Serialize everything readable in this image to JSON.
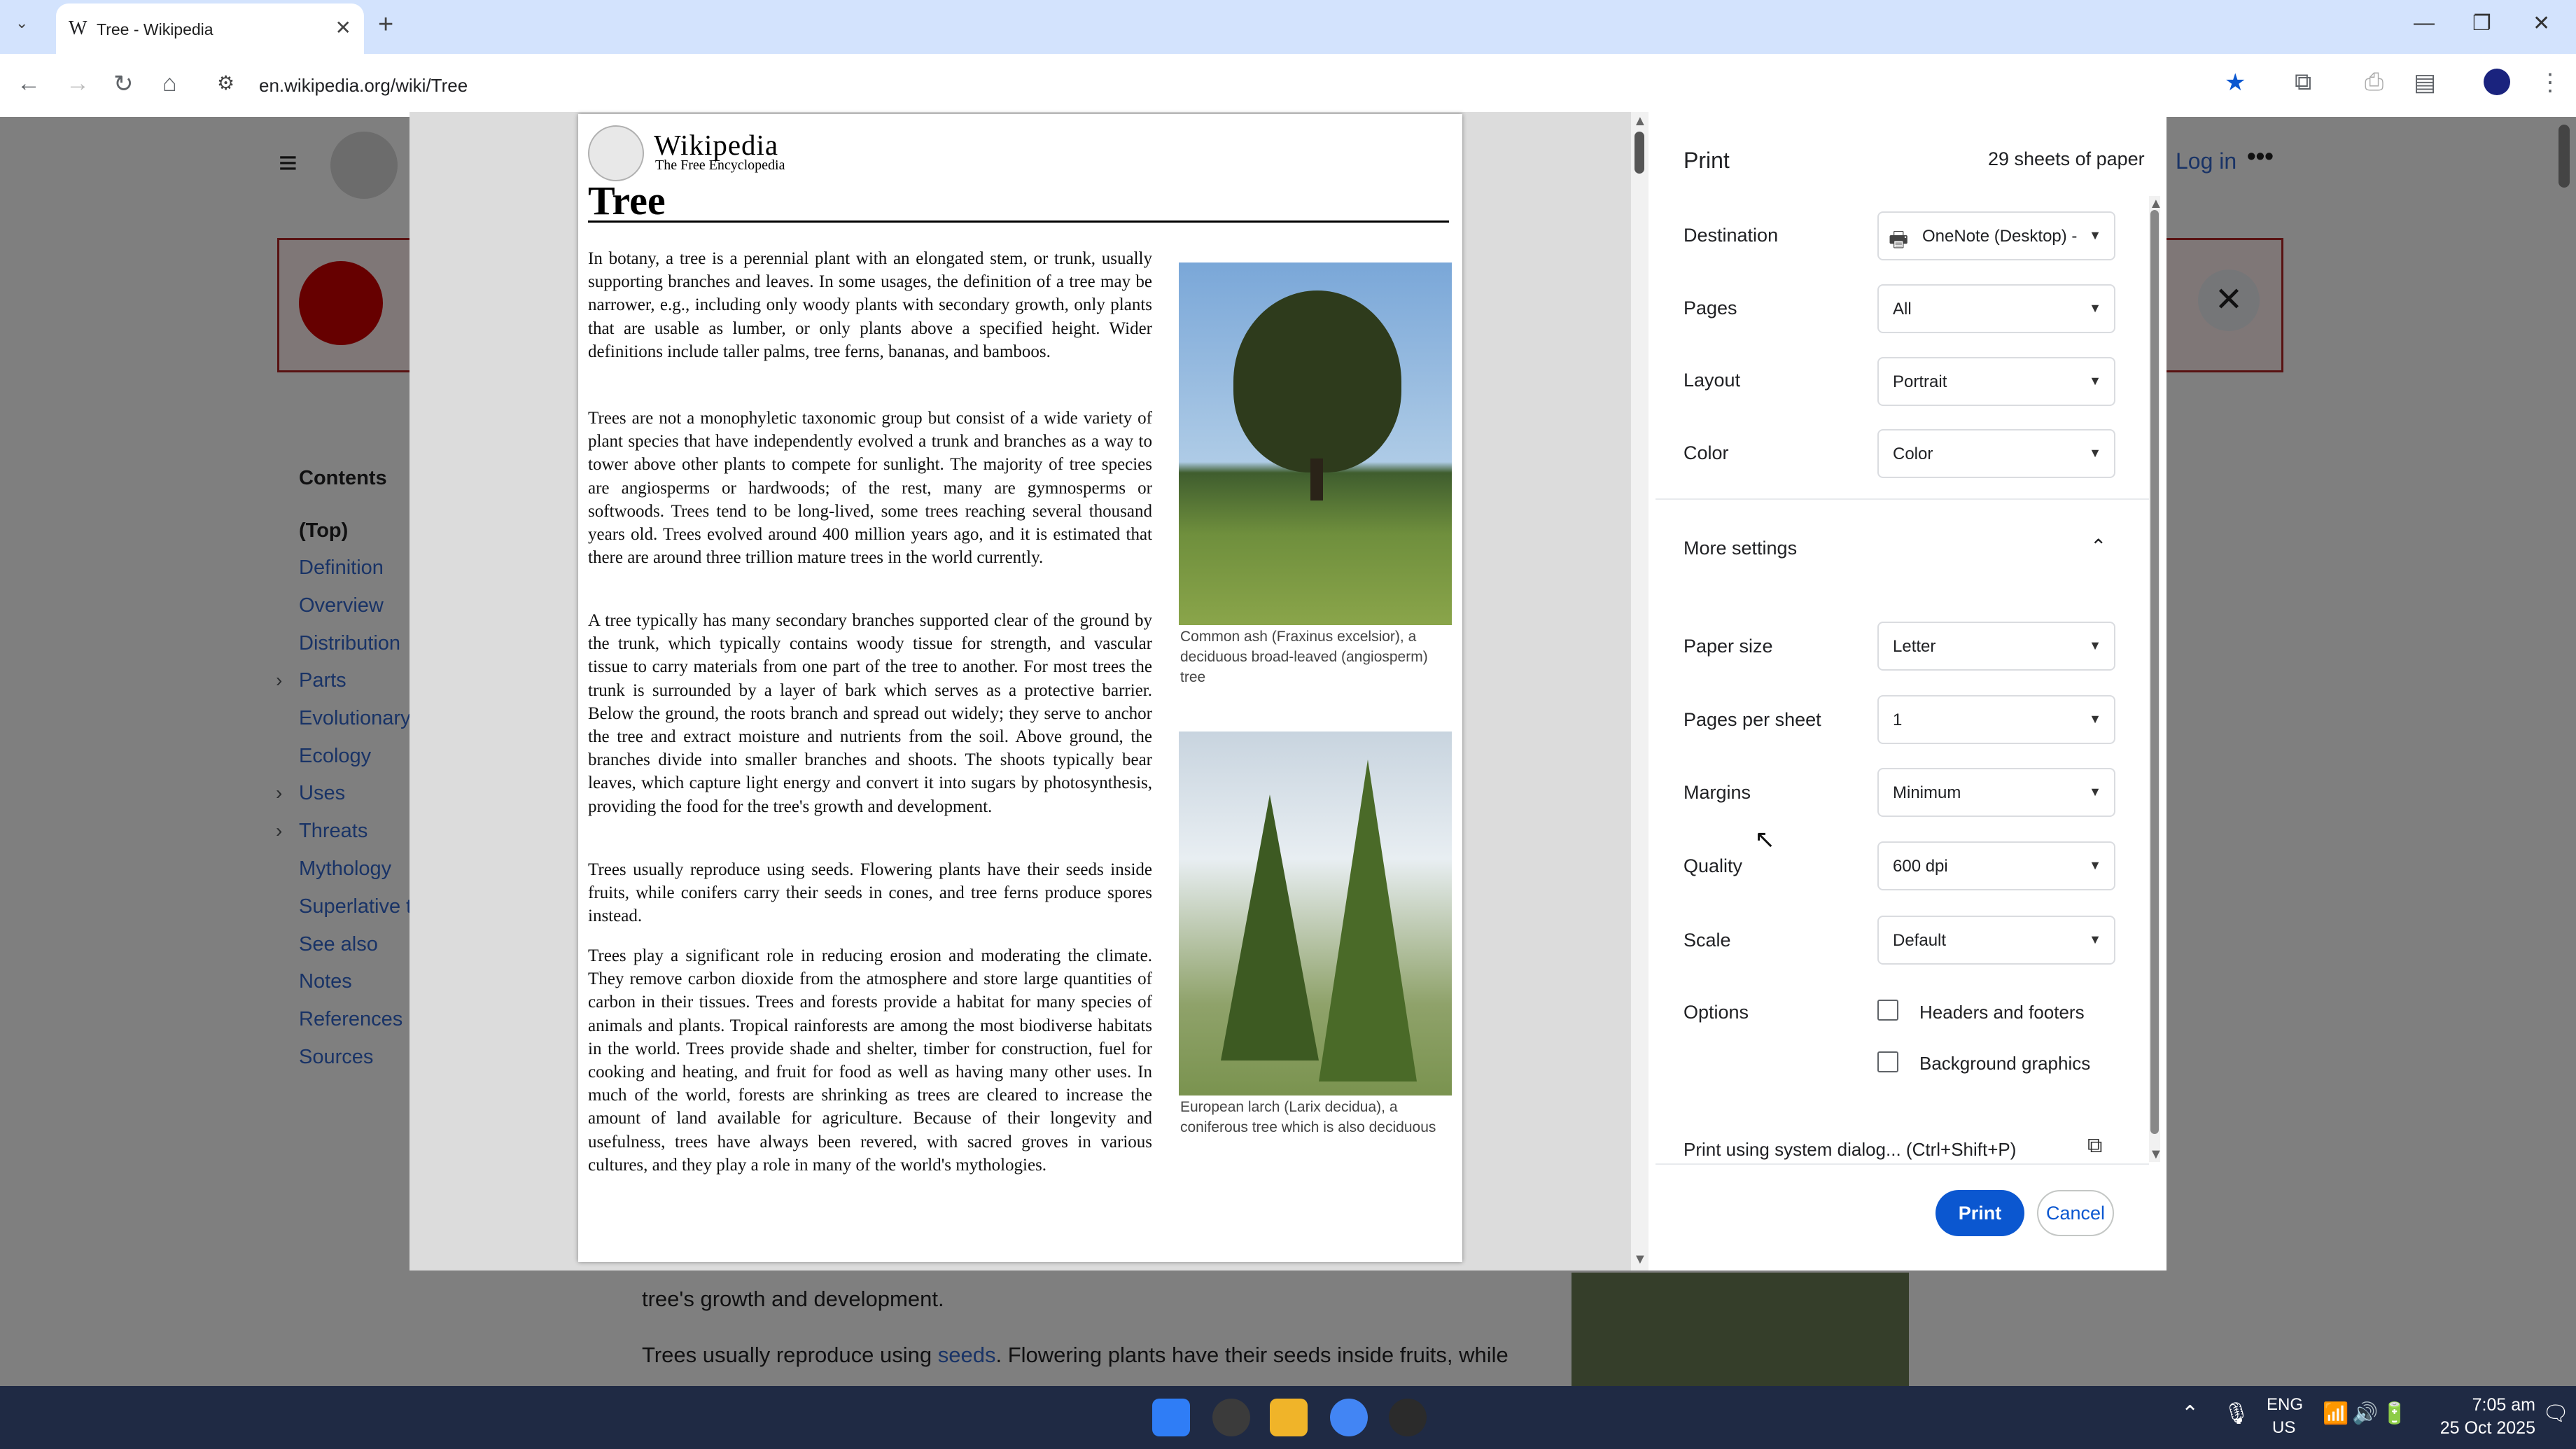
{
  "browser": {
    "tab_title": "Tree - Wikipedia",
    "tab_favicon": "W",
    "url": "en.wikipedia.org/wiki/Tree",
    "icons": [
      "tab-search-icon",
      "close-icon",
      "plus-icon",
      "minimize-icon",
      "restore-icon",
      "close-window-icon",
      "back-icon",
      "forward-icon",
      "reload-icon",
      "home-icon",
      "site-info-icon",
      "bookmark-star-icon",
      "extensions-icon",
      "print-icon",
      "sidebar-icon",
      "profile-icon",
      "menu-icon"
    ]
  },
  "background_page": {
    "login": "Log in",
    "contents_title": "Contents",
    "toc": [
      "(Top)",
      "Definition",
      "Overview",
      "Distribution",
      "Parts",
      "Evolutionary",
      "Ecology",
      "Uses",
      "Threats",
      "Mythology",
      "Superlative tr",
      "See also",
      "Notes",
      "References",
      "Sources"
    ],
    "body_line1": "tree's growth and development.",
    "body_line2_pre": "Trees usually reproduce using ",
    "body_line2_link": "seeds",
    "body_line2_post": ". Flowering plants have their seeds inside fruits, while"
  },
  "preview": {
    "wordmark": "Wikipedia",
    "tagline": "The Free Encyclopedia",
    "title": "Tree",
    "paragraphs": [
      "In botany, a tree is a perennial plant with an elongated stem, or trunk, usually supporting branches and leaves. In some usages, the definition of a tree may be narrower, e.g., including only woody plants with secondary growth, only plants that are usable as lumber, or only plants above a specified height. Wider definitions include taller palms, tree ferns, bananas, and bamboos.",
      "Trees are not a monophyletic taxonomic group but consist of a wide variety of plant species that have independently evolved a trunk and branches as a way to tower above other plants to compete for sunlight. The majority of tree species are angiosperms or hardwoods; of the rest, many are gymnosperms or softwoods. Trees tend to be long-lived, some trees reaching several thousand years old. Trees evolved around 400 million years ago, and it is estimated that there are around three trillion mature trees in the world currently.",
      "A tree typically has many secondary branches supported clear of the ground by the trunk, which typically contains woody tissue for strength, and vascular tissue to carry materials from one part of the tree to another. For most trees the trunk is surrounded by a layer of bark which serves as a protective barrier. Below the ground, the roots branch and spread out widely; they serve to anchor the tree and extract moisture and nutrients from the soil. Above ground, the branches divide into smaller branches and shoots. The shoots typically bear leaves, which capture light energy and convert it into sugars by photosynthesis, providing the food for the tree's growth and development.",
      "Trees usually reproduce using seeds. Flowering plants have their seeds inside fruits, while conifers carry their seeds in cones, and tree ferns produce spores instead.",
      "Trees play a significant role in reducing erosion and moderating the climate. They remove carbon dioxide from the atmosphere and store large quantities of carbon in their tissues. Trees and forests provide a habitat for many species of animals and plants. Tropical rainforests are among the most biodiverse habitats in the world. Trees provide shade and shelter, timber for construction, fuel for cooking and heating, and fruit for food as well as having many other uses. In much of the world, forests are shrinking as trees are cleared to increase the amount of land available for agriculture. Because of their longevity and usefulness, trees have always been revered, with sacred groves in various cultures, and they play a role in many of the world's mythologies."
    ],
    "caption1": "Common ash (Fraxinus excelsior), a deciduous broad-leaved (angiosperm) tree",
    "caption2": "European larch (Larix decidua), a coniferous tree which is also deciduous"
  },
  "print": {
    "title": "Print",
    "sheets": "29 sheets of paper",
    "destination_label": "Destination",
    "destination_value": "OneNote (Desktop) -",
    "pages_label": "Pages",
    "pages_value": "All",
    "layout_label": "Layout",
    "layout_value": "Portrait",
    "color_label": "Color",
    "color_value": "Color",
    "more_settings": "More settings",
    "paper_size_label": "Paper size",
    "paper_size_value": "Letter",
    "pps_label": "Pages per sheet",
    "pps_value": "1",
    "margins_label": "Margins",
    "margins_value": "Minimum",
    "quality_label": "Quality",
    "quality_value": "600 dpi",
    "scale_label": "Scale",
    "scale_value": "Default",
    "options_label": "Options",
    "opt_headers": "Headers and footers",
    "opt_background": "Background graphics",
    "opt_headers_checked": false,
    "opt_background_checked": false,
    "system_dialog": "Print using system dialog... (Ctrl+Shift+P)",
    "print_button": "Print",
    "cancel_button": "Cancel"
  },
  "taskbar": {
    "lang1": "ENG",
    "lang2": "US",
    "time": "7:05 am",
    "date": "25 Oct 2025"
  }
}
